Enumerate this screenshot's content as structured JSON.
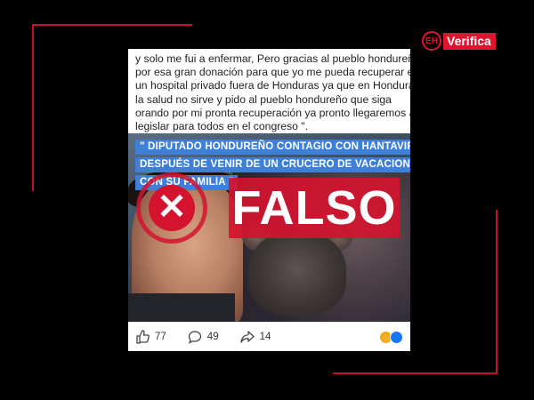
{
  "brand": {
    "badge_text": "EH",
    "name": "Verifica",
    "accent_color": "#e0142f"
  },
  "post": {
    "text_lines": [
      "y solo me fui a enfermar, Pero gracias al pueblo hondureño",
      "por esa gran donación para que yo me pueda recuperar en",
      "un hospital privado fuera de Honduras ya que en Honduras",
      "la salud no sirve y pido al pueblo hondureño que siga",
      "orando por mi pronta recuperación ya pronto llegaremos a",
      "legislar para todos en el congreso \"."
    ],
    "image_caption_lines": [
      "\" DIPUTADO HONDUREÑO CONTAGIO CON HANTAVIRUS",
      "DESPUÉS DE VENIR DE UN CRUCERO DE VACACIONES",
      "CON SU FAMILIA \""
    ],
    "actions": {
      "likes": "77",
      "comments": "49",
      "shares": "14"
    },
    "reaction_icons": [
      "haha-reaction-icon",
      "like-reaction-icon"
    ]
  },
  "verdict": {
    "label": "FALSO",
    "symbol": "✕",
    "color": "#d4132f"
  }
}
